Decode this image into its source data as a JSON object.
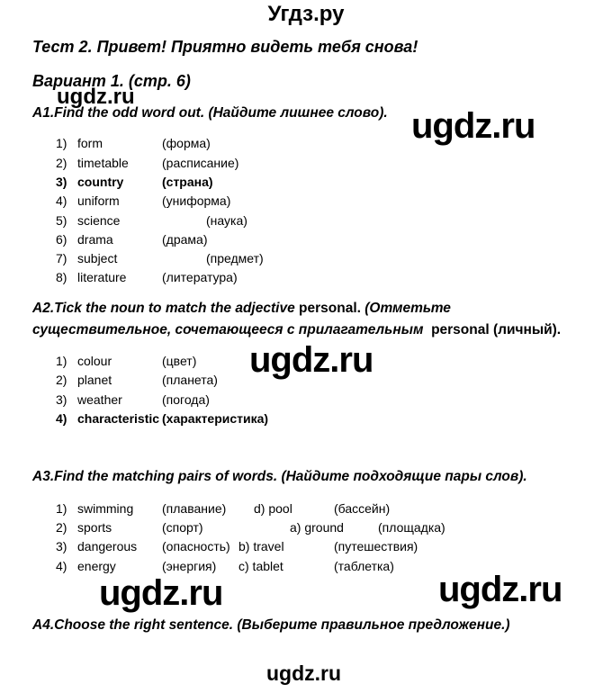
{
  "header": {
    "site_title": "Угдз.ру"
  },
  "test_title": "Тест 2. Привет! Приятно видеть тебя снова!",
  "variant": "Вариант 1. (стр. 6)",
  "watermarks": [
    "ugdz.ru",
    "ugdz.ru",
    "ugdz.ru",
    "ugdz.ru",
    "ugdz.ru",
    "ugdz.ru"
  ],
  "a1": {
    "question": "A1.Find the odd word out. (Найдите лишнее слово).",
    "items": [
      {
        "num": "1)",
        "en": "form",
        "ru": "(форма)",
        "bold": false
      },
      {
        "num": "2)",
        "en": "timetable",
        "ru": "(расписание)",
        "bold": false
      },
      {
        "num": "3)",
        "en": "country",
        "ru": "(страна)",
        "bold": true
      },
      {
        "num": "4)",
        "en": "uniform",
        "ru": "(униформа)",
        "bold": false
      },
      {
        "num": "5)",
        "en": "science",
        "ru": "(наука)",
        "bold": false
      },
      {
        "num": "6)",
        "en": "drama",
        "ru": "(драма)",
        "bold": false
      },
      {
        "num": "7)",
        "en": "subject",
        "ru": "(предмет)",
        "bold": false
      },
      {
        "num": "8)",
        "en": "literature",
        "ru": "(литература)",
        "bold": false
      }
    ]
  },
  "a2": {
    "question_part1": "A2.Tick the noun to match the adjective",
    "question_word": "personal.",
    "question_part2": "(Отметьте",
    "question_line2": "существительное, сочетающееся с прилагательным",
    "question_line2_word": "personal (личный).",
    "items": [
      {
        "num": "1)",
        "en": "colour",
        "ru": "(цвет)",
        "bold": false
      },
      {
        "num": "2)",
        "en": "planet",
        "ru": "(планета)",
        "bold": false
      },
      {
        "num": "3)",
        "en": "weather",
        "ru": "(погода)",
        "bold": false
      },
      {
        "num": "4)",
        "en": "characteristic",
        "ru": "(характеристика)",
        "bold": true
      }
    ]
  },
  "a3": {
    "question": "A3.Find the matching pairs of words. (Найдите подходящие пары слов).",
    "items": [
      {
        "num": "1)",
        "en": "swimming",
        "ru": "(плавание)",
        "match": "d) pool",
        "match_ru": "(бассейн)"
      },
      {
        "num": "2)",
        "en": "sports",
        "ru": "(спорт)",
        "match": "a) ground",
        "match_ru": "(площадка)"
      },
      {
        "num": "3)",
        "en": "dangerous",
        "ru": "(опасность)",
        "match": "b) travel",
        "match_ru": "(путешествия)"
      },
      {
        "num": "4)",
        "en": "energy",
        "ru": "(энергия)",
        "match": "c) tablet",
        "match_ru": "(таблетка)"
      }
    ]
  },
  "a4": {
    "question": "A4.Choose the right sentence. (Выберите правильное предложение.)"
  }
}
